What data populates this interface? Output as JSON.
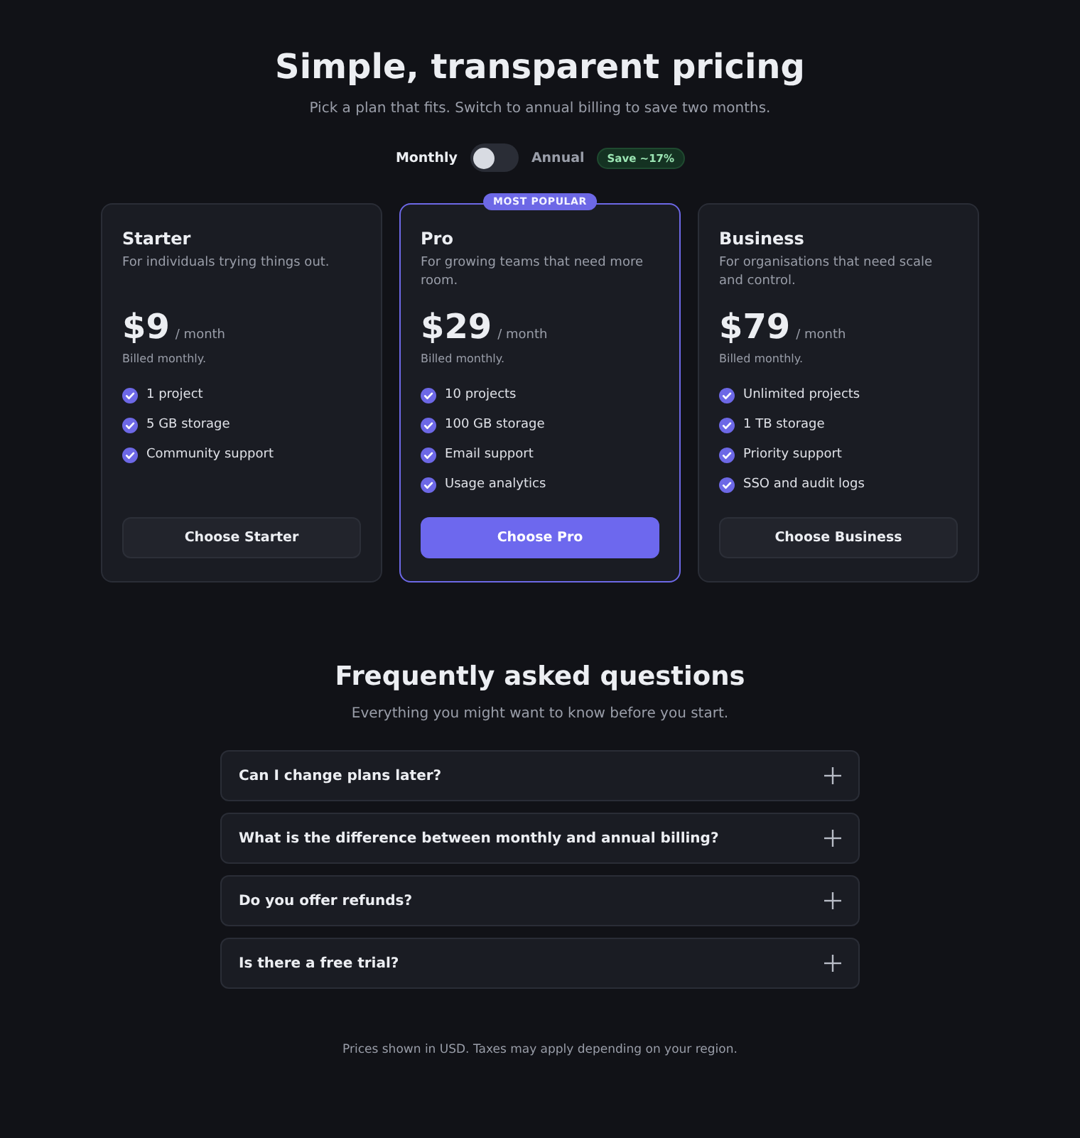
{
  "header": {
    "title": "Simple, transparent pricing",
    "subtitle": "Pick a plan that fits. Switch to annual billing to save two months."
  },
  "billing": {
    "options": [
      {
        "label": "Monthly",
        "selected": true
      },
      {
        "label": "Annual",
        "selected": false
      }
    ],
    "toggle": {
      "on": false
    },
    "badge": "Save ~17%"
  },
  "plans": [
    {
      "name": "Starter",
      "description": "For individuals trying things out.",
      "price": "$9",
      "period": "/ month",
      "billing_note": "Billed monthly.",
      "features": [
        "1 project",
        "5 GB storage",
        "Community support"
      ],
      "button": "Choose Starter",
      "featured": false
    },
    {
      "name": "Pro",
      "badge": "MOST POPULAR",
      "description": "For growing teams that need more room.",
      "price": "$29",
      "period": "/ month",
      "billing_note": "Billed monthly.",
      "features": [
        "10 projects",
        "100 GB storage",
        "Email support",
        "Usage analytics"
      ],
      "button": "Choose Pro",
      "featured": true
    },
    {
      "name": "Business",
      "description": "For organisations that need scale and control.",
      "price": "$79",
      "period": "/ month",
      "billing_note": "Billed monthly.",
      "features": [
        "Unlimited projects",
        "1 TB storage",
        "Priority support",
        "SSO and audit logs"
      ],
      "button": "Choose Business",
      "featured": false
    }
  ],
  "faq": {
    "title": "Frequently asked questions",
    "subtitle": "Everything you might want to know before you start.",
    "items": [
      {
        "question": "Can I change plans later?",
        "expanded": false
      },
      {
        "question": "What is the difference between monthly and annual billing?",
        "expanded": false
      },
      {
        "question": "Do you offer refunds?",
        "expanded": false
      },
      {
        "question": "Is there a free trial?",
        "expanded": false
      }
    ]
  },
  "footer": "Prices shown in USD. Taxes may apply depending on your region."
}
